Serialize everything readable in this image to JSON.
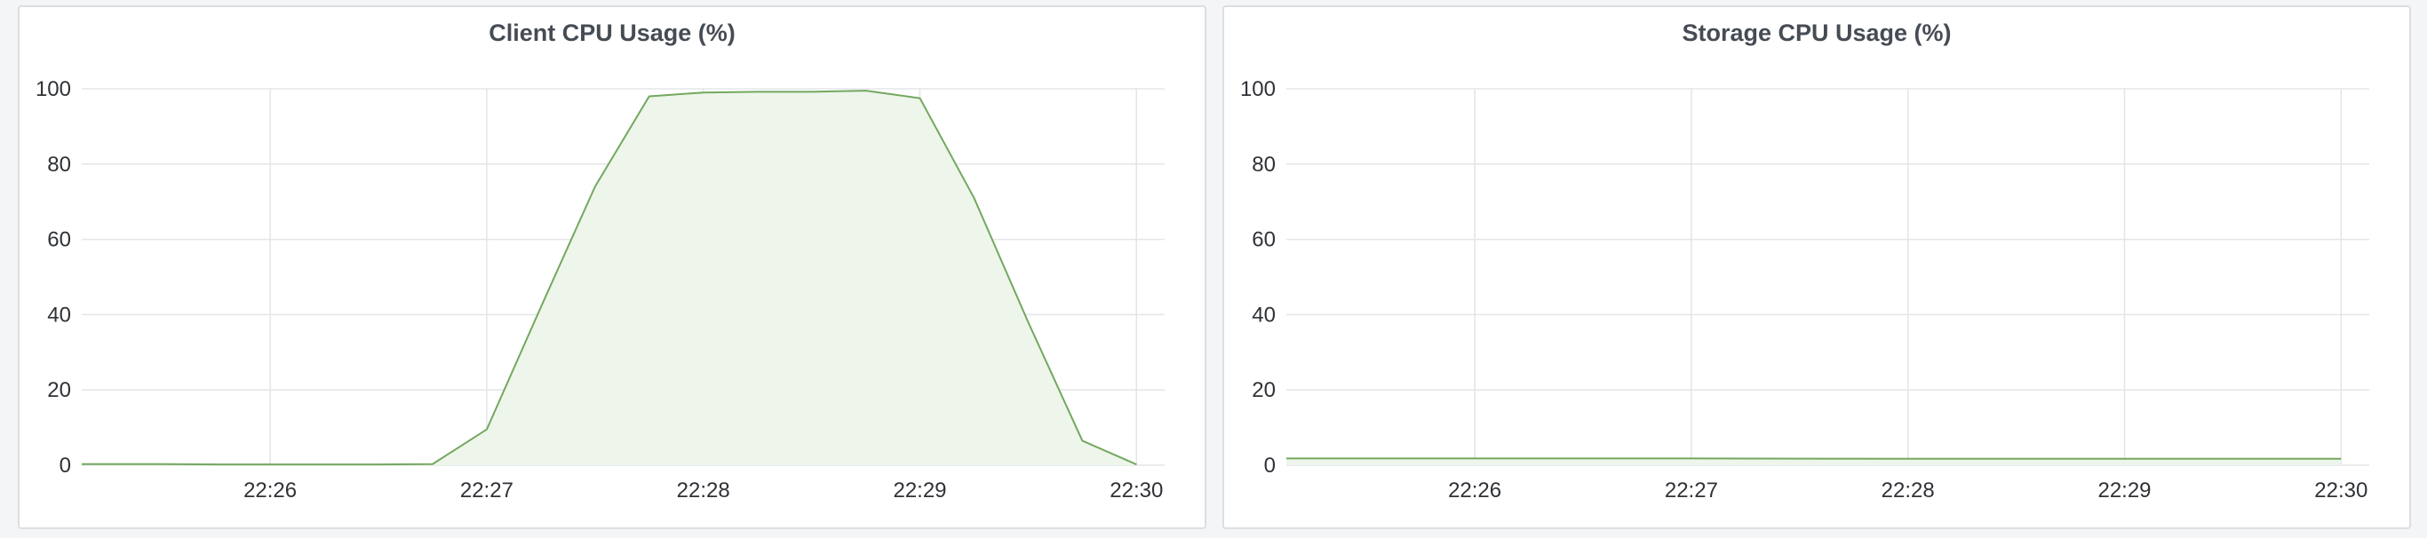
{
  "colors": {
    "line": "#73a85f",
    "fill": "#eef5ea",
    "grid": "#e4e5e8",
    "text": "#2f3237"
  },
  "chart_data": [
    {
      "type": "area",
      "title": "Client CPU Usage (%)",
      "ylim": [
        0,
        100
      ],
      "y_ticks": [
        "0",
        "20",
        "40",
        "60",
        "80",
        "100"
      ],
      "x_ticks": [
        "22:26",
        "22:27",
        "22:28",
        "22:29",
        "22:30"
      ],
      "xlim_minutes": [
        -0.87,
        4.13
      ],
      "grid": true,
      "series": [
        {
          "x": [
            -0.87,
            -0.5,
            -0.25,
            0,
            0.25,
            0.5,
            0.75,
            1.0,
            1.25,
            1.5,
            1.75,
            2.0,
            2.25,
            2.5,
            2.75,
            3.0,
            3.25,
            3.5,
            3.75,
            4.0
          ],
          "values": [
            0.3,
            0.3,
            0.2,
            0.2,
            0.2,
            0.2,
            0.3,
            9.5,
            42,
            74,
            98,
            99,
            99.2,
            99.2,
            99.5,
            97.5,
            71,
            38,
            6.5,
            0.2
          ]
        }
      ]
    },
    {
      "type": "area",
      "title": "Storage CPU Usage (%)",
      "ylim": [
        0,
        100
      ],
      "y_ticks": [
        "0",
        "20",
        "40",
        "60",
        "80",
        "100"
      ],
      "x_ticks": [
        "22:26",
        "22:27",
        "22:28",
        "22:29",
        "22:30"
      ],
      "xlim_minutes": [
        -0.87,
        4.13
      ],
      "grid": true,
      "series": [
        {
          "x": [
            -0.87,
            0,
            1.0,
            2.0,
            3.0,
            4.0
          ],
          "values": [
            1.8,
            1.8,
            1.8,
            1.7,
            1.7,
            1.7
          ]
        }
      ]
    }
  ]
}
